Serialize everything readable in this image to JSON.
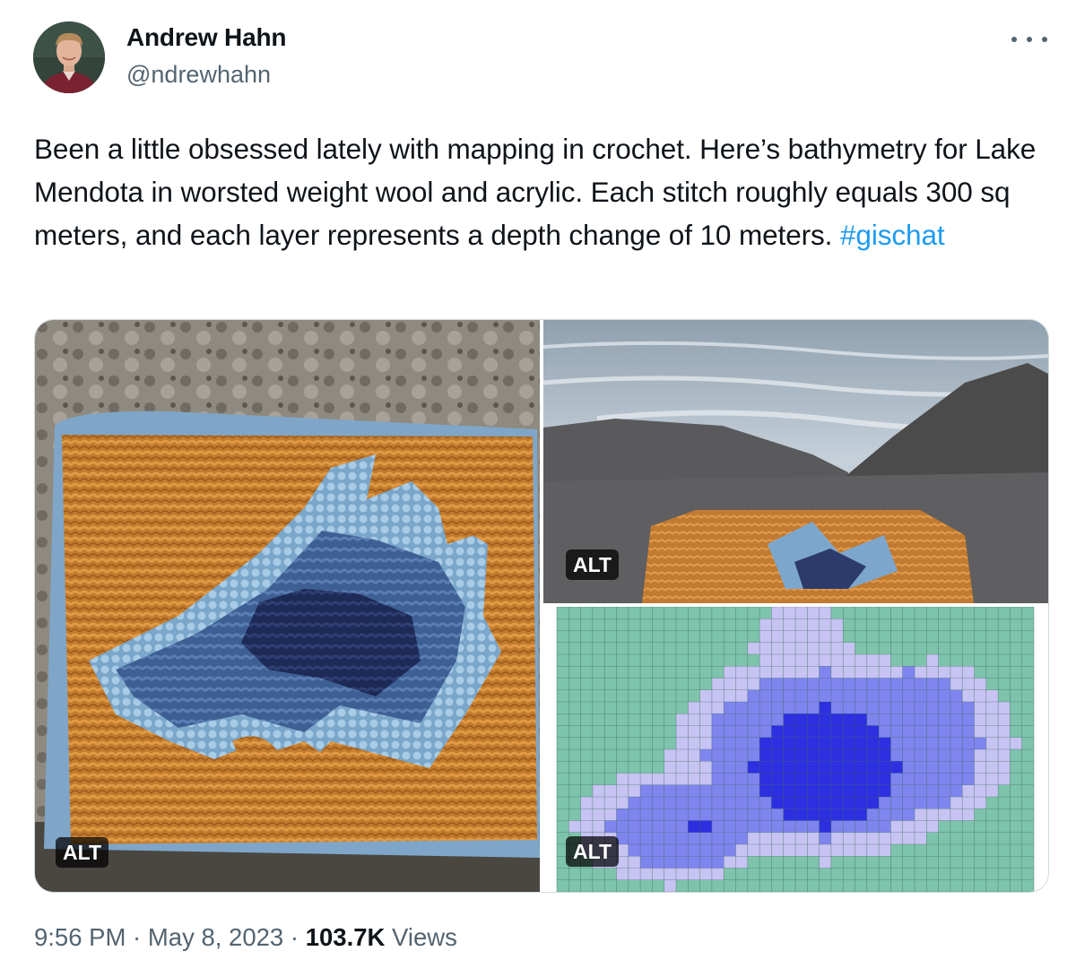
{
  "author": {
    "name": "Andrew Hahn",
    "handle": "@ndrewhahn"
  },
  "tweet": {
    "text": "Been a little obsessed lately with mapping in crochet. Here’s bathymetry for Lake Mendota in worsted weight wool and acrylic. Each stitch roughly equals 300 sq meters, and each layer represents a depth change of 10 meters. ",
    "hashtag": "#gischat"
  },
  "media": {
    "alt_label_1": "ALT",
    "alt_label_2": "ALT",
    "alt_label_3": "ALT"
  },
  "meta": {
    "time": "9:56 PM",
    "sep1": " · ",
    "date": "May 8, 2023",
    "sep2": " · ",
    "views_count": "103.7K",
    "views_label": " Views"
  },
  "icons": {
    "more": "more-horizontal-icon"
  },
  "colors": {
    "link": "#1d9bf0",
    "secondary_text": "#536471",
    "primary_text": "#0f1419",
    "border": "#cfd9de",
    "grid_land": "#7ec3ab",
    "grid_shallow": "#c7c3f2",
    "grid_mid": "#7f85ee",
    "grid_deep": "#2d2fe0"
  }
}
